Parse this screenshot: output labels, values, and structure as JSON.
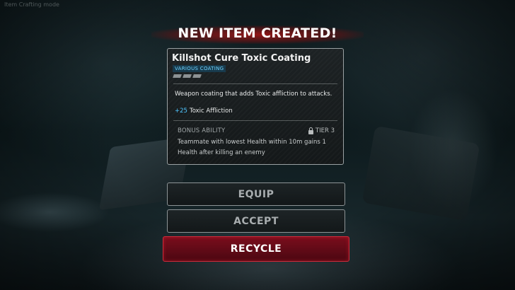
{
  "window": {
    "top_hint": "Item Crafting mode"
  },
  "header": {
    "title": "NEW ITEM CREATED!"
  },
  "item": {
    "name": "Killshot Cure Toxic Coating",
    "tag": "VARIOUS COATING",
    "slots_count": 3,
    "description": "Weapon coating that adds Toxic affliction to attacks.",
    "stat": {
      "value": "+25",
      "name": "Toxic Affliction"
    },
    "bonus": {
      "label": "BONUS ABILITY",
      "tier": "TIER 3",
      "text": "Teammate with lowest Health within 10m gains 1 Health after killing an enemy"
    }
  },
  "buttons": {
    "equip": "EQUIP",
    "accept": "ACCEPT",
    "recycle": "RECYCLE"
  },
  "colors": {
    "title_glow": "#be1414",
    "stat_accent": "#4fc6ff",
    "tag_text": "#6fd3ff",
    "recycle_bg": "#7a0d1c",
    "recycle_border": "#d02a3a"
  },
  "icons": {
    "lock": "lock-icon"
  }
}
